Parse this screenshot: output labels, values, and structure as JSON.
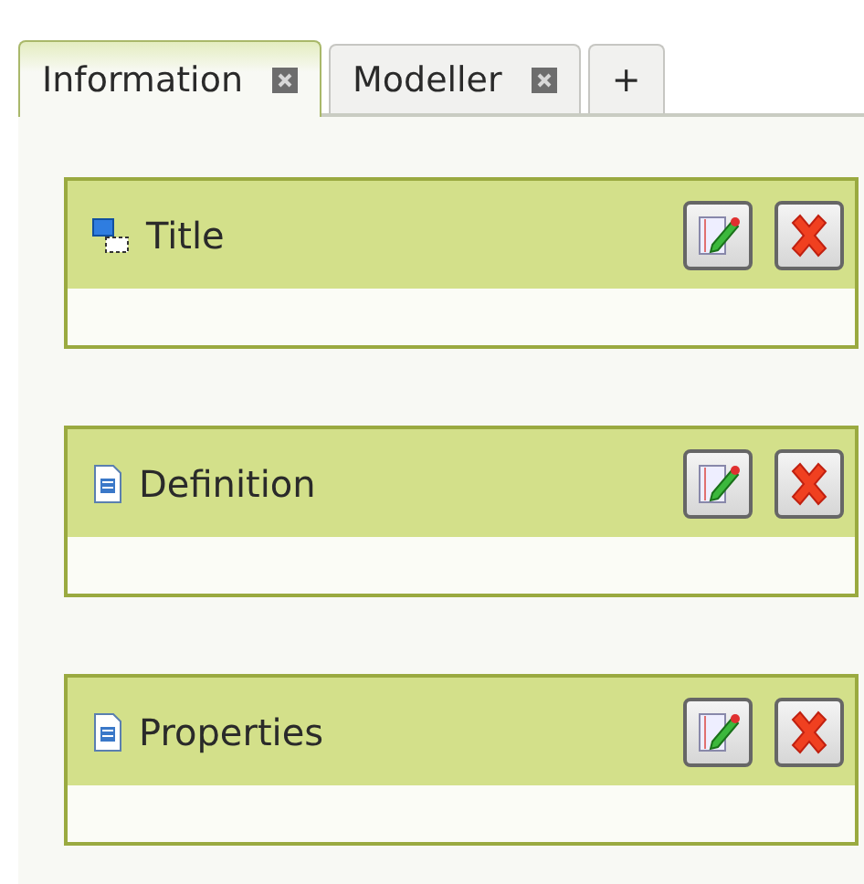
{
  "tabs": [
    {
      "label": "Information",
      "selected": true,
      "closable": true
    },
    {
      "label": "Modeller",
      "selected": false,
      "closable": true
    },
    {
      "label": "+",
      "selected": false,
      "closable": false
    }
  ],
  "panels": [
    {
      "title": "Title",
      "kind": "layout"
    },
    {
      "title": "Definition",
      "kind": "document"
    },
    {
      "title": "Properties",
      "kind": "document"
    }
  ]
}
